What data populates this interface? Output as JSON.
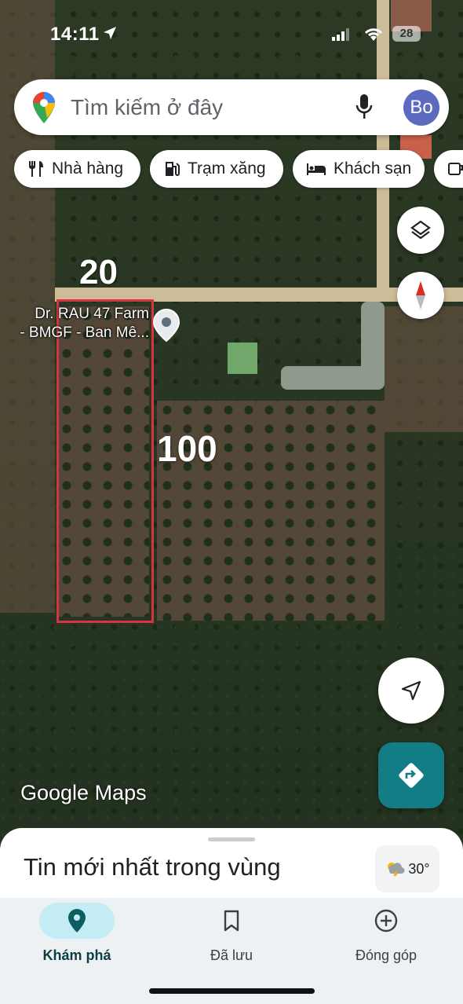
{
  "status_bar": {
    "time": "14:11",
    "battery": "28"
  },
  "search": {
    "placeholder": "Tìm kiếm ở đây",
    "avatar_initials": "Bo"
  },
  "chips": [
    {
      "label": "Nhà hàng",
      "icon": "fork-knife-icon"
    },
    {
      "label": "Trạm xăng",
      "icon": "gas-station-icon"
    },
    {
      "label": "Khách sạn",
      "icon": "bed-icon"
    }
  ],
  "map": {
    "annotation_width": "20",
    "annotation_length": "100",
    "place_label_line1": "Dr. RAU 47 Farm",
    "place_label_line2": "- BMGF - Ban Mê...",
    "attribution": "Google Maps"
  },
  "sheet": {
    "title": "Tin mới nhất trong vùng",
    "weather": "30°",
    "weather_icon": "thunderstorm-icon"
  },
  "bottom_nav": [
    {
      "label": "Khám phá",
      "icon": "explore-pin-icon",
      "active": true
    },
    {
      "label": "Đã lưu",
      "icon": "bookmark-icon",
      "active": false
    },
    {
      "label": "Đóng góp",
      "icon": "add-circle-icon",
      "active": false
    }
  ],
  "colors": {
    "accent": "#127d84",
    "annotation_box": "#d93240",
    "active_nav_pill": "#c4ecf4"
  }
}
